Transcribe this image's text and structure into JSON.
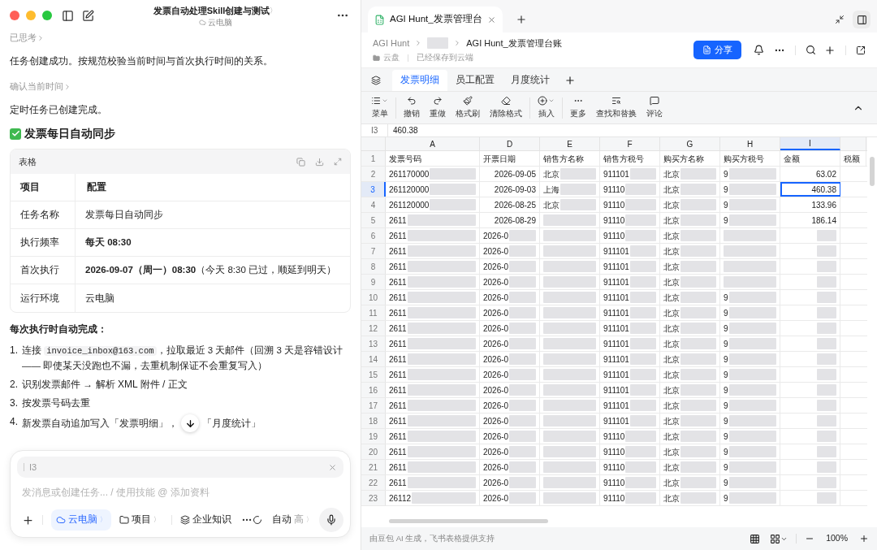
{
  "chat": {
    "title": "发票自动处理Skill创建与测试",
    "title_chevron": "〉",
    "location": "云电脑",
    "thought_1": "已思考",
    "text_1": "任务创建成功。按规范校验当前时间与首次执行时间的关系。",
    "thought_2": "确认当前时间",
    "text_2": "定时任务已创建完成。",
    "heading": "发票每日自动同步",
    "table": {
      "label": "表格",
      "columns": [
        "项目",
        "配置"
      ],
      "rows": [
        {
          "item": "任务名称",
          "value": "发票每日自动同步",
          "bold": false
        },
        {
          "item": "执行频率",
          "value": "每天 08:30",
          "bold": true
        },
        {
          "item": "首次执行",
          "value": "**2026-09-07（周一）08:30**（今天 8:30 已过，顺延到明天）",
          "bold": false
        },
        {
          "item": "运行环境",
          "value": "云电脑",
          "bold": false
        }
      ]
    },
    "list_intro": "每次执行时自动完成：",
    "steps": [
      {
        "marker": "1.",
        "before": "连接",
        "code": "invoice_inbox@163.com",
        "after": "，拉取最近 3 天邮件（回溯 3 天是容错设计 —— 即使某天没跑也不漏，去重机制保证不会重复写入）"
      },
      {
        "marker": "2.",
        "before": "识别发票邮件 → 解析 XML 附件 / 正文"
      },
      {
        "marker": "3.",
        "before": "按发票号码去重"
      },
      {
        "marker": "4.",
        "before": "新发票自动追加写入「发票明细」，",
        "after_button": "「月度统计」"
      }
    ]
  },
  "composer": {
    "reference": "I3",
    "placeholder": "发消息或创建任务... / 使用技能 @ 添加资料",
    "chips": [
      {
        "label": "云电脑",
        "chevron": "〉",
        "selected": true
      },
      {
        "label": "项目",
        "chevron": "〉",
        "selected": false
      }
    ],
    "knowledge": "企业知识",
    "mode": "自动",
    "mode_level": "高",
    "mode_chevron": "〉"
  },
  "sheet": {
    "tab_title": "AGI Hunt_发票管理台",
    "breadcrumb": [
      "AGI Hunt",
      "AGI Hunt_发票管理台账"
    ],
    "location": "云盘",
    "save_status": "已经保存到云端",
    "share": "分享",
    "sheets": [
      {
        "label": "发票明细",
        "selected": true
      },
      {
        "label": "员工配置",
        "selected": false
      },
      {
        "label": "月度统计",
        "selected": false
      }
    ],
    "toolbar": [
      [
        "菜单"
      ],
      [
        "撤销",
        "重做",
        "格式刷",
        "清除格式"
      ],
      [
        "插入"
      ],
      [
        "更多",
        "查找和替换",
        "评论"
      ]
    ],
    "formula": {
      "cell": "I3",
      "value": "460.38"
    },
    "header_row": "1",
    "columns": [
      {
        "letter": "A",
        "header": "发票号码",
        "selected": false
      },
      {
        "letter": "D",
        "header": "开票日期",
        "selected": false
      },
      {
        "letter": "E",
        "header": "销售方名称",
        "selected": false
      },
      {
        "letter": "F",
        "header": "销售方税号",
        "selected": false
      },
      {
        "letter": "G",
        "header": "购买方名称",
        "selected": false
      },
      {
        "letter": "H",
        "header": "购买方税号",
        "selected": false
      },
      {
        "letter": "I",
        "header": "金额",
        "selected": true
      },
      {
        "header": "税额",
        "selected": false
      }
    ],
    "rows": [
      {
        "n": "2",
        "a": "261170000",
        "d": "2026-09-05",
        "e": "北京",
        "f": "911101",
        "g": "北京",
        "h": "9",
        "i": "63.02",
        "selected": false
      },
      {
        "n": "3",
        "a": "261120000",
        "d": "2026-09-03",
        "e": "上海",
        "f": "91110",
        "g": "北京",
        "h": "9",
        "i": "460.38",
        "selected": true
      },
      {
        "n": "4",
        "a": "261120000",
        "d": "2026-08-25",
        "e": "北京",
        "f": "91110",
        "g": "北京",
        "h": "9",
        "i": "133.96",
        "selected": false
      },
      {
        "n": "5",
        "a": "2611",
        "d": "2026-08-29",
        "f": "91110",
        "g": "北京",
        "h": "9",
        "i": "186.14",
        "selected": false
      },
      {
        "n": "6",
        "a": "2611",
        "d": "2026-0",
        "f": "91110",
        "g": "北京",
        "selected": false
      },
      {
        "n": "7",
        "a": "2611",
        "d": "2026-0",
        "f": "911101",
        "g": "北京",
        "selected": false
      },
      {
        "n": "8",
        "a": "2611",
        "d": "2026-0",
        "f": "911101",
        "g": "北京",
        "selected": false
      },
      {
        "n": "9",
        "a": "2611",
        "d": "2026-0",
        "f": "911101",
        "g": "北京",
        "selected": false
      },
      {
        "n": "10",
        "a": "2611",
        "d": "2026-0",
        "f": "911101",
        "g": "北京",
        "h": "9",
        "selected": false
      },
      {
        "n": "11",
        "a": "2611",
        "d": "2026-0",
        "f": "911101",
        "g": "北京",
        "h": "9",
        "selected": false
      },
      {
        "n": "12",
        "a": "2611",
        "d": "2026-0",
        "f": "911101",
        "g": "北京",
        "h": "9",
        "selected": false
      },
      {
        "n": "13",
        "a": "2611",
        "d": "2026-0",
        "f": "911101",
        "g": "北京",
        "h": "9",
        "selected": false
      },
      {
        "n": "14",
        "a": "2611",
        "d": "2026-0",
        "f": "911101",
        "g": "北京",
        "h": "9",
        "selected": false
      },
      {
        "n": "15",
        "a": "2611",
        "d": "2026-0",
        "f": "911101",
        "g": "北京",
        "h": "9",
        "selected": false
      },
      {
        "n": "16",
        "a": "2611",
        "d": "2026-0",
        "f": "911101",
        "g": "北京",
        "h": "9",
        "selected": false
      },
      {
        "n": "17",
        "a": "2611",
        "d": "2026-0",
        "f": "911101",
        "g": "北京",
        "h": "9",
        "selected": false
      },
      {
        "n": "18",
        "a": "2611",
        "d": "2026-0",
        "f": "911101",
        "g": "北京",
        "h": "9",
        "selected": false
      },
      {
        "n": "19",
        "a": "2611",
        "d": "2026-0",
        "f": "91110",
        "g": "北京",
        "h": "9",
        "selected": false
      },
      {
        "n": "20",
        "a": "2611",
        "d": "2026-0",
        "f": "91110",
        "g": "北京",
        "h": "9",
        "selected": false
      },
      {
        "n": "21",
        "a": "2611",
        "d": "2026-0",
        "f": "91110",
        "g": "北京",
        "h": "9",
        "selected": false
      },
      {
        "n": "22",
        "a": "2611",
        "d": "2026-0",
        "f": "91110",
        "g": "北京",
        "h": "9",
        "selected": false
      },
      {
        "n": "23",
        "a": "26112",
        "d": "2026-0",
        "f": "91110",
        "g": "北京",
        "h": "9",
        "selected": false
      }
    ],
    "footer": "由豆包 AI 生成，飞书表格提供支持",
    "zoom": "100%"
  }
}
